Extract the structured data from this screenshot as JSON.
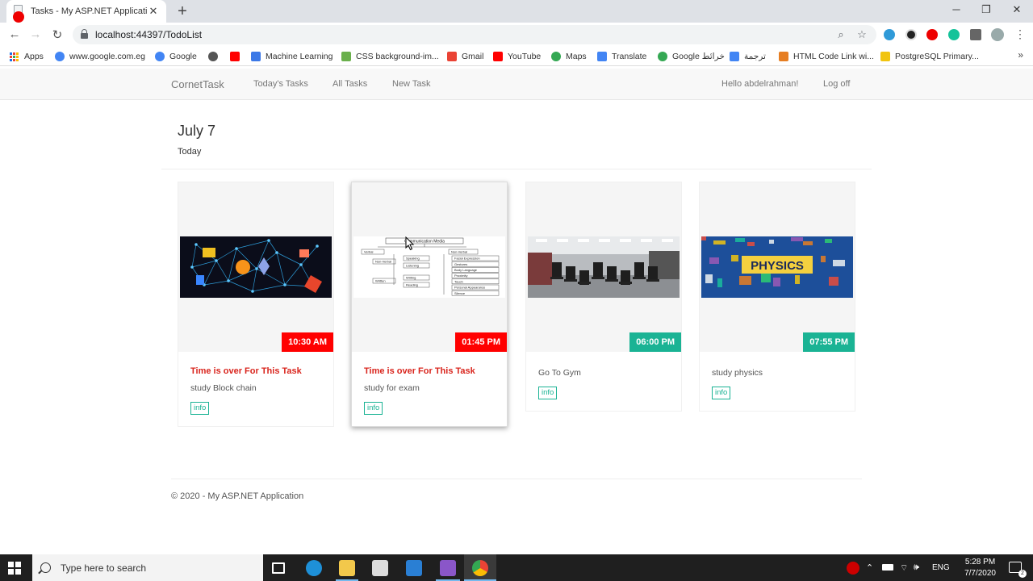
{
  "browser": {
    "tab_title": "Tasks - My ASP.NET Application",
    "tab_close": "✕",
    "new_tab": "+",
    "url": "localhost:44397/TodoList",
    "window_controls": {
      "minimize": "─",
      "maximize": "❐",
      "close": "✕"
    },
    "nav": {
      "back": "←",
      "forward": "→",
      "reload": "↻"
    },
    "omni_icons": {
      "zoom": "⌕",
      "star": "☆"
    },
    "menu": "⋮",
    "bookmarks": [
      {
        "label": "Apps",
        "icon": "apps-grid-icon"
      },
      {
        "label": "www.google.com.eg",
        "icon": "google-icon",
        "color": "#4285f4"
      },
      {
        "label": "Google",
        "icon": "google-icon",
        "color": "#4285f4"
      },
      {
        "label": "",
        "icon": "globe-icon",
        "color": "#555555"
      },
      {
        "label": "",
        "icon": "youtube-icon",
        "color": "#ff0000"
      },
      {
        "label": "Machine Learning",
        "icon": "link-icon",
        "color": "#3b78e7"
      },
      {
        "label": "CSS background-im...",
        "icon": "image-icon",
        "color": "#6ab04c"
      },
      {
        "label": "Gmail",
        "icon": "gmail-icon",
        "color": "#ea4335"
      },
      {
        "label": "YouTube",
        "icon": "youtube-icon",
        "color": "#ff0000"
      },
      {
        "label": "Maps",
        "icon": "maps-icon",
        "color": "#34a853"
      },
      {
        "label": "Translate",
        "icon": "translate-icon",
        "color": "#4285f4"
      },
      {
        "label": "Google خرائط",
        "icon": "maps-icon",
        "color": "#34a853"
      },
      {
        "label": "ترجمة",
        "icon": "translate-icon",
        "color": "#4285f4"
      },
      {
        "label": "HTML Code Link wi...",
        "icon": "pencil-icon",
        "color": "#e67e22"
      },
      {
        "label": "PostgreSQL Primary...",
        "icon": "postgres-icon",
        "color": "#f1c40f"
      }
    ],
    "bookmarks_more": "»"
  },
  "app_nav": {
    "brand": "CornetTask",
    "links": [
      "Today's Tasks",
      "All Tasks",
      "New Task"
    ],
    "greeting": "Hello abdelrahman!",
    "logoff": "Log off"
  },
  "page": {
    "date": "July 7",
    "subtitle": "Today"
  },
  "tasks": [
    {
      "time": "10:30 AM",
      "status": "Time is over For This Task",
      "name": "study Block chain",
      "action": "info",
      "overdue": true,
      "image": "blockchain"
    },
    {
      "time": "01:45 PM",
      "status": "Time is over For This Task",
      "name": "study for exam",
      "action": "info",
      "overdue": true,
      "image": "diagram"
    },
    {
      "time": "06:00 PM",
      "status": "",
      "name": "Go To Gym",
      "action": "info",
      "overdue": false,
      "image": "gym"
    },
    {
      "time": "07:55 PM",
      "status": "",
      "name": "study physics",
      "action": "info",
      "overdue": false,
      "image": "physics"
    }
  ],
  "thumb_text": {
    "physics": "PHYSICS",
    "diagram_title": "Communication Media",
    "diagram_labels": [
      "Verbal",
      "Non-Verbal",
      "Oral",
      "Speaking",
      "Listening",
      "Written",
      "Writing",
      "Reading",
      "Facial Expression",
      "Gestures",
      "Body Language",
      "Proximity",
      "Touch",
      "Personal Appearance",
      "Silence"
    ]
  },
  "footer": "© 2020 - My ASP.NET Application",
  "taskbar": {
    "search_placeholder": "Type here to search",
    "language": "ENG",
    "time": "5:28 PM",
    "date": "7/7/2020",
    "notification_count": "2"
  },
  "colors": {
    "overdue_badge": "#ff0000",
    "upcoming_badge": "#1ab394",
    "overdue_text": "#d9251d"
  }
}
